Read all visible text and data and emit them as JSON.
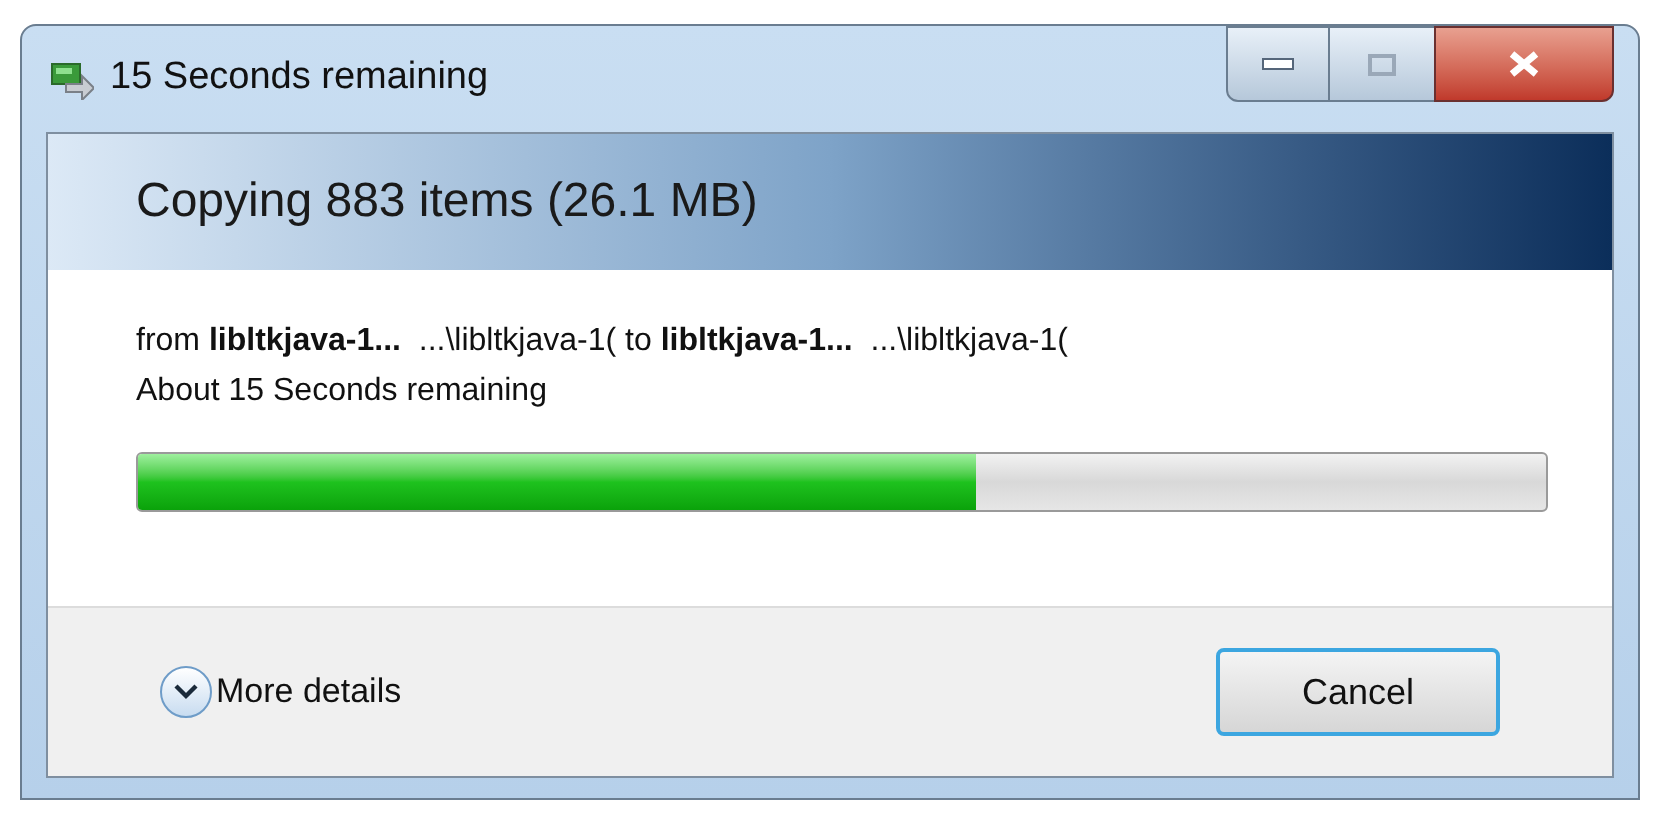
{
  "window": {
    "title": "15 Seconds remaining"
  },
  "header": {
    "title": "Copying 883 items (26.1 MB)"
  },
  "details": {
    "from_line": "from **libltkjava-1...**  ...\\libltkjava-1( to **libltkjava-1...**  ...\\libltkjava-1(",
    "time_remaining": "About 15 Seconds remaining"
  },
  "progress": {
    "level": 0.595
  },
  "footer": {
    "more_details": {
      "label": "More details",
      "expanded": false
    },
    "buttons": [
      "Cancel"
    ]
  }
}
